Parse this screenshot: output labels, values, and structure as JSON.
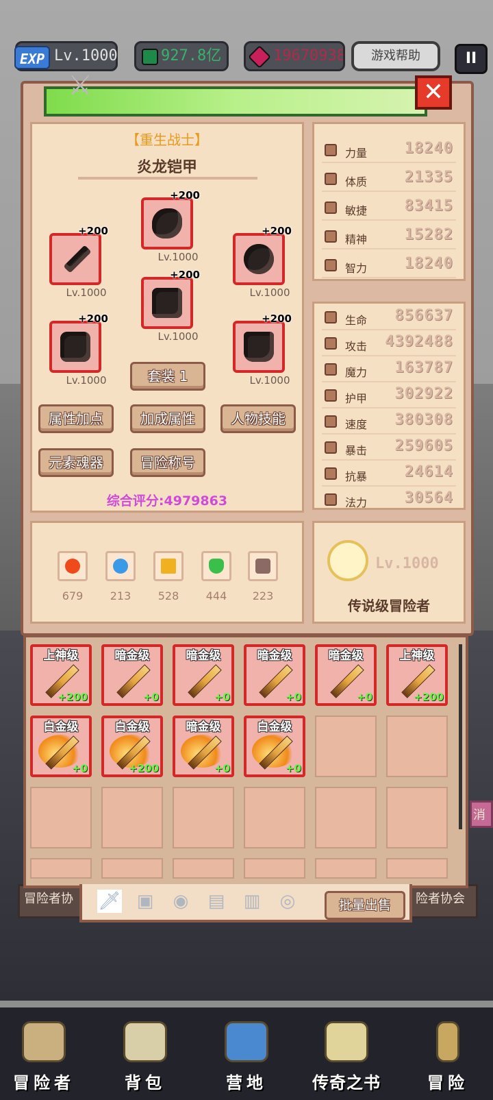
{
  "topbar": {
    "exp_badge": "EXP",
    "level": "Lv.1000",
    "emerald": "927.8亿",
    "ruby": "19670938",
    "help": "游戏帮助",
    "pause": "II"
  },
  "panel": {
    "class_title": "【重生战士】",
    "armor_title": "炎龙铠甲",
    "close": "✕",
    "equipment": [
      {
        "plus": "+200",
        "level": "Lv.1000"
      },
      {
        "plus": "+200",
        "level": "Lv.1000"
      },
      {
        "plus": "+200",
        "level": "Lv.1000"
      },
      {
        "plus": "+200",
        "level": "Lv.1000"
      },
      {
        "plus": "+200",
        "level": "Lv.1000"
      },
      {
        "plus": "+200",
        "level": "Lv.1000"
      }
    ],
    "set_button": "套装 1",
    "buttons": [
      "属性加点",
      "加成属性",
      "人物技能",
      "元素魂器",
      "冒险称号"
    ],
    "score": "综合评分:4979863",
    "base_stats": [
      {
        "label": "力量",
        "value": "18240"
      },
      {
        "label": "体质",
        "value": "21335"
      },
      {
        "label": "敏捷",
        "value": "83415"
      },
      {
        "label": "精神",
        "value": "15282"
      },
      {
        "label": "智力",
        "value": "18240"
      }
    ],
    "combat_stats": [
      {
        "label": "生命",
        "value": "856637"
      },
      {
        "label": "攻击",
        "value": "4392488"
      },
      {
        "label": "魔力",
        "value": "163787"
      },
      {
        "label": "护甲",
        "value": "302922"
      },
      {
        "label": "速度",
        "value": "380308"
      },
      {
        "label": "暴击",
        "value": "259605"
      },
      {
        "label": "抗暴",
        "value": "24614"
      },
      {
        "label": "法力",
        "value": "30564"
      }
    ],
    "elements": [
      {
        "name": "fire-icon",
        "count": "679",
        "color": "#f04a1a"
      },
      {
        "name": "water-icon",
        "count": "213",
        "color": "#3a9ae8"
      },
      {
        "name": "lightning-icon",
        "count": "528",
        "color": "#f0b020"
      },
      {
        "name": "wind-icon",
        "count": "444",
        "color": "#3ac04a"
      },
      {
        "name": "skull-icon",
        "count": "223",
        "color": "#8a6a62"
      }
    ],
    "legend": {
      "level": "Lv.1000",
      "title": "传说级冒险者"
    }
  },
  "inventory": {
    "items": [
      {
        "grade": "上神级",
        "bonus": "+200",
        "kind": "sword"
      },
      {
        "grade": "暗金级",
        "bonus": "+0",
        "kind": "sword"
      },
      {
        "grade": "暗金级",
        "bonus": "+0",
        "kind": "sword"
      },
      {
        "grade": "暗金级",
        "bonus": "+0",
        "kind": "sword"
      },
      {
        "grade": "暗金级",
        "bonus": "+0",
        "kind": "sword"
      },
      {
        "grade": "上神级",
        "bonus": "+200",
        "kind": "sword"
      },
      {
        "grade": "白金级",
        "bonus": "+0",
        "kind": "flame"
      },
      {
        "grade": "白金级",
        "bonus": "+200",
        "kind": "flame"
      },
      {
        "grade": "暗金级",
        "bonus": "+0",
        "kind": "flame"
      },
      {
        "grade": "白金级",
        "bonus": "+0",
        "kind": "flame"
      }
    ],
    "sell_button": "批量出售"
  },
  "background": {
    "left_tile": "冒险者协",
    "right_tile": "险者协会",
    "tag": "消"
  },
  "nav": [
    {
      "label": "冒险者",
      "icon": "helmet-icon"
    },
    {
      "label": "背包",
      "icon": "backpack-icon"
    },
    {
      "label": "营地",
      "icon": "camp-icon"
    },
    {
      "label": "传奇之书",
      "icon": "book-icon"
    },
    {
      "label": "冒险",
      "icon": "sword-icon"
    }
  ]
}
